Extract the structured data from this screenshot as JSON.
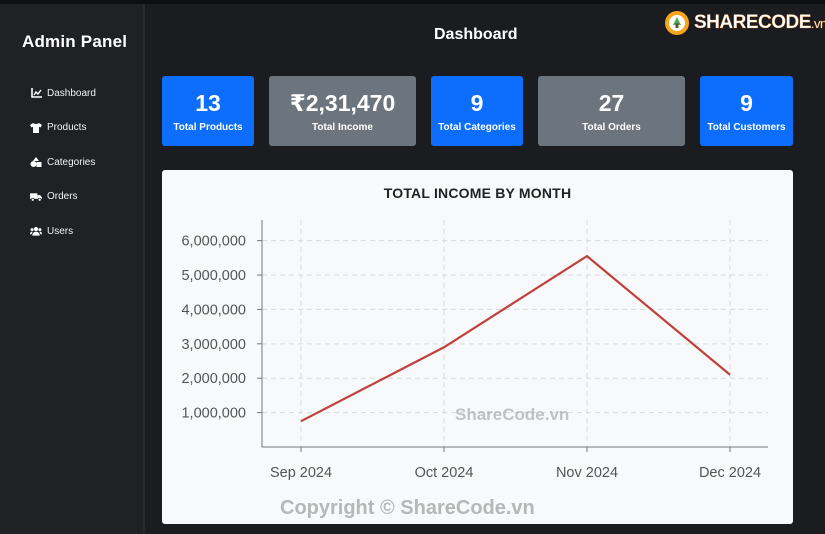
{
  "sidebar": {
    "brand": "Admin Panel",
    "items": [
      {
        "label": "Dashboard",
        "icon": "chart-line-icon"
      },
      {
        "label": "Products",
        "icon": "shirt-icon"
      },
      {
        "label": "Categories",
        "icon": "shapes-icon"
      },
      {
        "label": "Orders",
        "icon": "truck-icon"
      },
      {
        "label": "Users",
        "icon": "users-icon"
      }
    ]
  },
  "header": {
    "title": "Dashboard"
  },
  "stats": [
    {
      "value": "13",
      "label": "Total Products",
      "color": "#0d6efd"
    },
    {
      "value": "₹2,31,470",
      "label": "Total Income",
      "color": "#6c757d"
    },
    {
      "value": "9",
      "label": "Total Categories",
      "color": "#0d6efd"
    },
    {
      "value": "27",
      "label": "Total Orders",
      "color": "#6c757d"
    },
    {
      "value": "9",
      "label": "Total Customers",
      "color": "#0d6efd"
    }
  ],
  "chart_data": {
    "type": "line",
    "title": "TOTAL INCOME BY MONTH",
    "categories": [
      "Sep 2024",
      "Oct 2024",
      "Nov 2024",
      "Dec 2024"
    ],
    "values": [
      750000,
      2900000,
      5550000,
      2100000
    ],
    "ylim": [
      0,
      6600000
    ],
    "yticks": [
      1000000,
      2000000,
      3000000,
      4000000,
      5000000,
      6000000
    ],
    "ytick_labels": [
      "1,000,000",
      "2,000,000",
      "3,000,000",
      "4,000,000",
      "5,000,000",
      "6,000,000"
    ],
    "grid": true,
    "line_color": "#c0413b"
  },
  "watermarks": {
    "mid": "ShareCode.vn",
    "bottom": "Copyright © ShareCode.vn"
  },
  "logo": {
    "text": "SHARECODE",
    "suffix": ".vn"
  }
}
